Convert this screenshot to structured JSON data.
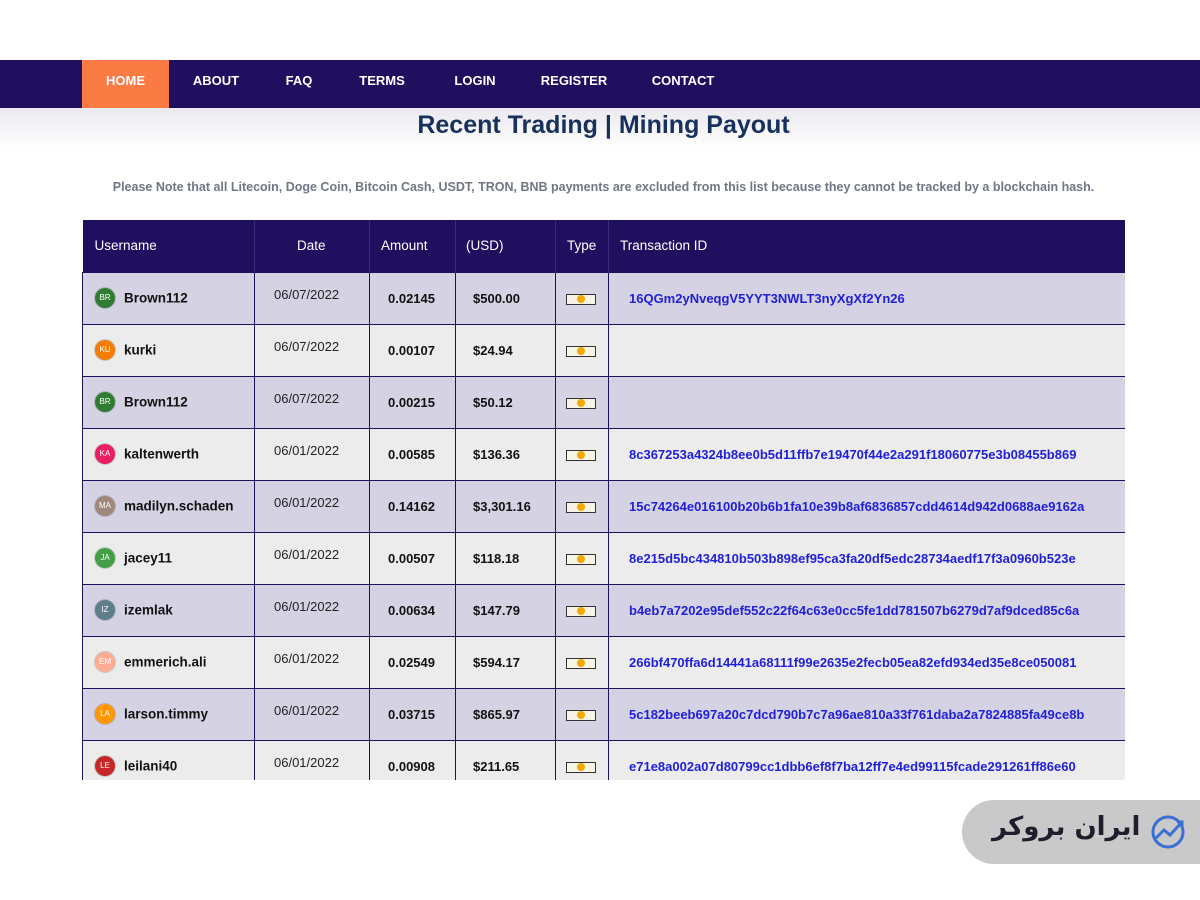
{
  "nav": {
    "items": [
      {
        "label": "HOME",
        "active": true
      },
      {
        "label": "ABOUT",
        "active": false
      },
      {
        "label": "FAQ",
        "active": false
      },
      {
        "label": "TERMS",
        "active": false
      },
      {
        "label": "LOGIN",
        "active": false
      },
      {
        "label": "REGISTER",
        "active": false
      },
      {
        "label": "CONTACT",
        "active": false
      }
    ]
  },
  "page": {
    "title": "Recent Trading | Mining Payout",
    "notice": "Please Note that all Litecoin, Doge Coin, Bitcoin Cash, USDT, TRON, BNB payments are excluded from this list because they cannot be tracked by a blockchain hash."
  },
  "table": {
    "headers": {
      "username": "Username",
      "date": "Date",
      "amount": "Amount",
      "usd": "(USD)",
      "type": "Type",
      "txid": "Transaction ID"
    },
    "rows": [
      {
        "initials": "BR",
        "avatar_color": "#2e7d32",
        "username": "Brown112",
        "date": "06/07/2022",
        "amount": "0.02145",
        "usd": "$500.00",
        "type_icon": "bitcoin-icon",
        "txid": "16QGm2yNveqgV5YYT3NWLT3nyXgXf2Yn26"
      },
      {
        "initials": "KU",
        "avatar_color": "#f57c00",
        "username": "kurki",
        "date": "06/07/2022",
        "amount": "0.00107",
        "usd": "$24.94",
        "type_icon": "bitcoin-icon",
        "txid": ""
      },
      {
        "initials": "BR",
        "avatar_color": "#2e7d32",
        "username": "Brown112",
        "date": "06/07/2022",
        "amount": "0.00215",
        "usd": "$50.12",
        "type_icon": "bitcoin-icon",
        "txid": ""
      },
      {
        "initials": "KA",
        "avatar_color": "#e91e63",
        "username": "kaltenwerth",
        "date": "06/01/2022",
        "amount": "0.00585",
        "usd": "$136.36",
        "type_icon": "bitcoin-icon",
        "txid": "8c367253a4324b8ee0b5d11ffb7e19470f44e2a291f18060775e3b08455b869"
      },
      {
        "initials": "MA",
        "avatar_color": "#a1887f",
        "username": "madilyn.schaden",
        "date": "06/01/2022",
        "amount": "0.14162",
        "usd": "$3,301.16",
        "type_icon": "bitcoin-icon",
        "txid": "15c74264e016100b20b6b1fa10e39b8af6836857cdd4614d942d0688ae9162a"
      },
      {
        "initials": "JA",
        "avatar_color": "#43a047",
        "username": "jacey11",
        "date": "06/01/2022",
        "amount": "0.00507",
        "usd": "$118.18",
        "type_icon": "bitcoin-icon",
        "txid": "8e215d5bc434810b503b898ef95ca3fa20df5edc28734aedf17f3a0960b523e"
      },
      {
        "initials": "IZ",
        "avatar_color": "#607d8b",
        "username": "izemlak",
        "date": "06/01/2022",
        "amount": "0.00634",
        "usd": "$147.79",
        "type_icon": "bitcoin-icon",
        "txid": "b4eb7a7202e95def552c22f64c63e0cc5fe1dd781507b6279d7af9dced85c6a"
      },
      {
        "initials": "EM",
        "avatar_color": "#ffab91",
        "username": "emmerich.ali",
        "date": "06/01/2022",
        "amount": "0.02549",
        "usd": "$594.17",
        "type_icon": "bitcoin-icon",
        "txid": "266bf470ffa6d14441a68111f99e2635e2fecb05ea82efd934ed35e8ce050081"
      },
      {
        "initials": "LA",
        "avatar_color": "#ff9800",
        "username": "larson.timmy",
        "date": "06/01/2022",
        "amount": "0.03715",
        "usd": "$865.97",
        "type_icon": "bitcoin-icon",
        "txid": "5c182beeb697a20c7dcd790b7c7a96ae810a33f761daba2a7824885fa49ce8b"
      },
      {
        "initials": "LE",
        "avatar_color": "#c62828",
        "username": "leilani40",
        "date": "06/01/2022",
        "amount": "0.00908",
        "usd": "$211.65",
        "type_icon": "bitcoin-icon",
        "txid": "e71e8a002a07d80799cc1dbb6ef8f7ba12ff7e4ed99115fcade291261ff86e60"
      }
    ]
  },
  "watermark": {
    "text": "ایران بروکر",
    "icon": "chart-trend-icon"
  }
}
